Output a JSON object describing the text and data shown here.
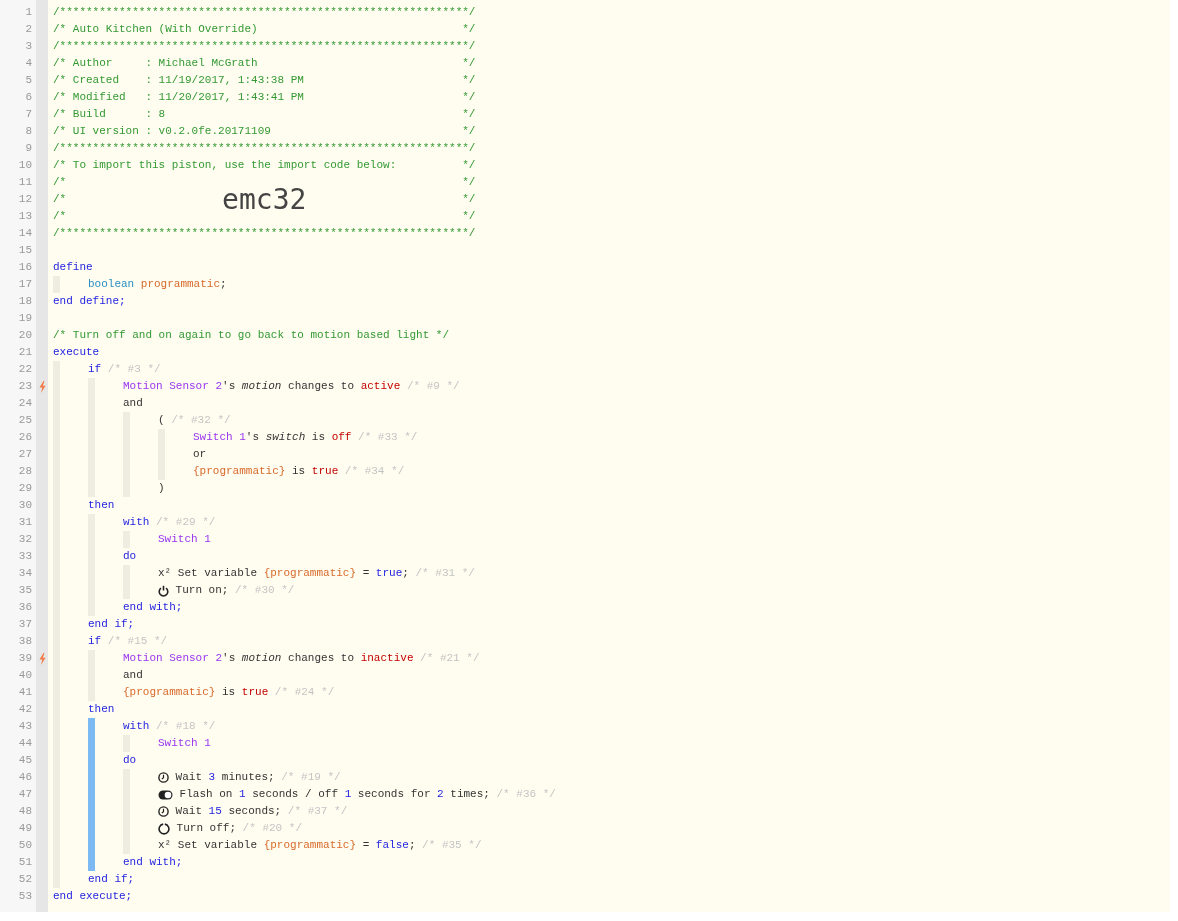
{
  "lines": [
    {
      "number": "1",
      "kind": "banner",
      "trigger": false,
      "text": "/**************************************************************/"
    },
    {
      "number": "2",
      "kind": "banner",
      "trigger": false,
      "text": "/* Auto Kitchen (With Override)",
      "end": "*/"
    },
    {
      "number": "3",
      "kind": "banner",
      "trigger": false,
      "text": "/**************************************************************/"
    },
    {
      "number": "4",
      "kind": "banner",
      "trigger": false,
      "text": "/* Author     : Michael McGrath",
      "end": "*/"
    },
    {
      "number": "5",
      "kind": "banner",
      "trigger": false,
      "text": "/* Created    : 11/19/2017, 1:43:38 PM",
      "end": "*/"
    },
    {
      "number": "6",
      "kind": "banner",
      "trigger": false,
      "text": "/* Modified   : 11/20/2017, 1:43:41 PM",
      "end": "*/"
    },
    {
      "number": "7",
      "kind": "banner",
      "trigger": false,
      "text": "/* Build      : 8",
      "end": "*/"
    },
    {
      "number": "8",
      "kind": "banner",
      "trigger": false,
      "text": "/* UI version : v0.2.0fe.20171109",
      "end": "*/"
    },
    {
      "number": "9",
      "kind": "banner",
      "trigger": false,
      "text": "/**************************************************************/"
    },
    {
      "number": "10",
      "kind": "banner",
      "trigger": false,
      "text": "/* To import this piston, use the import code below:",
      "end": "*/"
    },
    {
      "number": "11",
      "kind": "banner",
      "trigger": false,
      "text": "/*",
      "end": "*/"
    },
    {
      "number": "12",
      "kind": "banner",
      "trigger": false,
      "text": "/*",
      "code": "emc32",
      "end": "*/"
    },
    {
      "number": "13",
      "kind": "banner",
      "trigger": false,
      "text": "/*",
      "end": "*/"
    },
    {
      "number": "14",
      "kind": "banner",
      "trigger": false,
      "text": "/**************************************************************/"
    },
    {
      "number": "15",
      "kind": "code",
      "trigger": false
    },
    {
      "number": "16",
      "kind": "code",
      "trigger": false,
      "tokens": [
        {
          "text": "define",
          "kind": "keyword"
        }
      ]
    },
    {
      "kind": "block",
      "highlighted": false,
      "children": [
        {
          "number": "17",
          "kind": "code",
          "trigger": false,
          "tokens": [
            {
              "text": "boolean ",
              "kind": "type"
            },
            {
              "text": "programmatic",
              "kind": "variable"
            },
            {
              "text": ";",
              "kind": "plain"
            }
          ]
        }
      ]
    },
    {
      "number": "18",
      "kind": "code",
      "trigger": false,
      "tokens": [
        {
          "text": "end define;",
          "kind": "keyword"
        }
      ]
    },
    {
      "number": "19",
      "kind": "code",
      "trigger": false
    },
    {
      "number": "20",
      "kind": "code",
      "trigger": false,
      "tokens": [
        {
          "text": "/* Turn off and on again to go back to motion based light */",
          "kind": "comment"
        }
      ]
    },
    {
      "number": "21",
      "kind": "code",
      "trigger": false,
      "tokens": [
        {
          "text": "execute",
          "kind": "keyword"
        }
      ]
    },
    {
      "kind": "block",
      "highlighted": false,
      "children": [
        {
          "number": "22",
          "kind": "code",
          "trigger": false,
          "tokens": [
            {
              "text": "if",
              "kind": "keyword"
            },
            {
              "text": " /* #3 */",
              "kind": "hint"
            }
          ]
        },
        {
          "kind": "block",
          "highlighted": false,
          "children": [
            {
              "number": "23",
              "kind": "code",
              "trigger": true,
              "tokens": [
                {
                  "text": "Motion Sensor 2",
                  "kind": "device"
                },
                {
                  "text": "'s ",
                  "kind": "plain"
                },
                {
                  "text": "motion",
                  "kind": "attribute"
                },
                {
                  "text": " changes to ",
                  "kind": "plain"
                },
                {
                  "text": "active",
                  "kind": "value"
                },
                {
                  "text": " /* #9 */",
                  "kind": "hint"
                }
              ]
            },
            {
              "number": "24",
              "kind": "code",
              "trigger": false,
              "tokens": [
                {
                  "text": "and",
                  "kind": "plain"
                }
              ]
            },
            {
              "kind": "block",
              "highlighted": false,
              "children": [
                {
                  "number": "25",
                  "kind": "code",
                  "trigger": false,
                  "tokens": [
                    {
                      "text": "(",
                      "kind": "plain"
                    },
                    {
                      "text": " /* #32 */",
                      "kind": "hint"
                    }
                  ]
                },
                {
                  "kind": "block",
                  "highlighted": false,
                  "children": [
                    {
                      "number": "26",
                      "kind": "code",
                      "trigger": false,
                      "tokens": [
                        {
                          "text": "Switch 1",
                          "kind": "device"
                        },
                        {
                          "text": "'s ",
                          "kind": "plain"
                        },
                        {
                          "text": "switch",
                          "kind": "attribute"
                        },
                        {
                          "text": " is ",
                          "kind": "plain"
                        },
                        {
                          "text": "off",
                          "kind": "value"
                        },
                        {
                          "text": " /* #33 */",
                          "kind": "hint"
                        }
                      ]
                    },
                    {
                      "number": "27",
                      "kind": "code",
                      "trigger": false,
                      "tokens": [
                        {
                          "text": "or",
                          "kind": "plain"
                        }
                      ]
                    },
                    {
                      "number": "28",
                      "kind": "code",
                      "trigger": false,
                      "tokens": [
                        {
                          "text": "{programmatic}",
                          "kind": "variable"
                        },
                        {
                          "text": " is ",
                          "kind": "plain"
                        },
                        {
                          "text": "true",
                          "kind": "value"
                        },
                        {
                          "text": " /* #34 */",
                          "kind": "hint"
                        }
                      ]
                    }
                  ]
                },
                {
                  "number": "29",
                  "kind": "code",
                  "trigger": false,
                  "tokens": [
                    {
                      "text": ")",
                      "kind": "plain"
                    }
                  ]
                }
              ]
            }
          ]
        },
        {
          "number": "30",
          "kind": "code",
          "trigger": false,
          "tokens": [
            {
              "text": "then",
              "kind": "keyword"
            }
          ]
        },
        {
          "kind": "block",
          "highlighted": false,
          "children": [
            {
              "number": "31",
              "kind": "code",
              "trigger": false,
              "tokens": [
                {
                  "text": "with",
                  "kind": "keyword"
                },
                {
                  "text": " /* #29 */",
                  "kind": "hint"
                }
              ]
            },
            {
              "kind": "block",
              "highlighted": false,
              "children": [
                {
                  "number": "32",
                  "kind": "code",
                  "trigger": false,
                  "tokens": [
                    {
                      "text": "Switch 1",
                      "kind": "device"
                    }
                  ]
                }
              ]
            },
            {
              "number": "33",
              "kind": "code",
              "trigger": false,
              "tokens": [
                {
                  "text": "do",
                  "kind": "keyword"
                }
              ]
            },
            {
              "kind": "block",
              "highlighted": false,
              "children": [
                {
                  "number": "34",
                  "kind": "code",
                  "trigger": false,
                  "tokens": [
                    {
                      "text": "x² Set variable ",
                      "kind": "plain"
                    },
                    {
                      "text": "{programmatic}",
                      "kind": "variable"
                    },
                    {
                      "text": " = ",
                      "kind": "plain"
                    },
                    {
                      "text": "true",
                      "kind": "literal"
                    },
                    {
                      "text": ";",
                      "kind": "plain"
                    },
                    {
                      "text": " /* #31 */",
                      "kind": "hint"
                    }
                  ]
                },
                {
                  "number": "35",
                  "kind": "code",
                  "trigger": false,
                  "tokens": [
                    {
                      "kind": "on"
                    },
                    {
                      "text": " Turn on;",
                      "kind": "plain"
                    },
                    {
                      "text": " /* #30 */",
                      "kind": "hint"
                    }
                  ]
                }
              ]
            },
            {
              "number": "36",
              "kind": "code",
              "trigger": false,
              "tokens": [
                {
                  "text": "end with;",
                  "kind": "keyword"
                }
              ]
            }
          ]
        },
        {
          "number": "37",
          "kind": "code",
          "trigger": false,
          "tokens": [
            {
              "text": "end if;",
              "kind": "keyword"
            }
          ]
        },
        {
          "number": "38",
          "kind": "code",
          "trigger": false,
          "tokens": [
            {
              "text": "if",
              "kind": "keyword"
            },
            {
              "text": " /* #15 */",
              "kind": "hint"
            }
          ]
        },
        {
          "kind": "block",
          "highlighted": false,
          "children": [
            {
              "number": "39",
              "kind": "code",
              "trigger": true,
              "tokens": [
                {
                  "text": "Motion Sensor 2",
                  "kind": "device"
                },
                {
                  "text": "'s ",
                  "kind": "plain"
                },
                {
                  "text": "motion",
                  "kind": "attribute"
                },
                {
                  "text": " changes to ",
                  "kind": "plain"
                },
                {
                  "text": "inactive",
                  "kind": "value"
                },
                {
                  "text": " /* #21 */",
                  "kind": "hint"
                }
              ]
            },
            {
              "number": "40",
              "kind": "code",
              "trigger": false,
              "tokens": [
                {
                  "text": "and",
                  "kind": "plain"
                }
              ]
            },
            {
              "number": "41",
              "kind": "code",
              "trigger": false,
              "tokens": [
                {
                  "text": "{programmatic}",
                  "kind": "variable"
                },
                {
                  "text": " is ",
                  "kind": "plain"
                },
                {
                  "text": "true",
                  "kind": "value"
                },
                {
                  "text": " /* #24 */",
                  "kind": "hint"
                }
              ]
            }
          ]
        },
        {
          "number": "42",
          "kind": "code",
          "trigger": false,
          "tokens": [
            {
              "text": "then",
              "kind": "keyword"
            }
          ]
        },
        {
          "kind": "block",
          "highlighted": true,
          "children": [
            {
              "number": "43",
              "kind": "code",
              "trigger": false,
              "tokens": [
                {
                  "text": "with",
                  "kind": "keyword"
                },
                {
                  "text": " /* #18 */",
                  "kind": "hint"
                }
              ]
            },
            {
              "kind": "block",
              "highlighted": false,
              "children": [
                {
                  "number": "44",
                  "kind": "code",
                  "trigger": false,
                  "tokens": [
                    {
                      "text": "Switch 1",
                      "kind": "device"
                    }
                  ]
                }
              ]
            },
            {
              "number": "45",
              "kind": "code",
              "trigger": false,
              "tokens": [
                {
                  "text": "do",
                  "kind": "keyword"
                }
              ]
            },
            {
              "kind": "block",
              "highlighted": false,
              "children": [
                {
                  "number": "46",
                  "kind": "code",
                  "trigger": false,
                  "tokens": [
                    {
                      "kind": "wait"
                    },
                    {
                      "text": " Wait ",
                      "kind": "plain"
                    },
                    {
                      "text": "3",
                      "kind": "literal"
                    },
                    {
                      "text": " minutes;",
                      "kind": "plain"
                    },
                    {
                      "text": " /* #19 */",
                      "kind": "hint"
                    }
                  ]
                },
                {
                  "number": "47",
                  "kind": "code",
                  "trigger": false,
                  "tokens": [
                    {
                      "kind": "flash"
                    },
                    {
                      "text": " Flash on ",
                      "kind": "plain"
                    },
                    {
                      "text": "1",
                      "kind": "literal"
                    },
                    {
                      "text": " seconds / off ",
                      "kind": "plain"
                    },
                    {
                      "text": "1",
                      "kind": "literal"
                    },
                    {
                      "text": " seconds for ",
                      "kind": "plain"
                    },
                    {
                      "text": "2",
                      "kind": "literal"
                    },
                    {
                      "text": " times;",
                      "kind": "plain"
                    },
                    {
                      "text": " /* #36 */",
                      "kind": "hint"
                    }
                  ]
                },
                {
                  "number": "48",
                  "kind": "code",
                  "trigger": false,
                  "tokens": [
                    {
                      "kind": "wait"
                    },
                    {
                      "text": " Wait ",
                      "kind": "plain"
                    },
                    {
                      "text": "15",
                      "kind": "literal"
                    },
                    {
                      "text": " seconds;",
                      "kind": "plain"
                    },
                    {
                      "text": " /* #37 */",
                      "kind": "hint"
                    }
                  ]
                },
                {
                  "number": "49",
                  "kind": "code",
                  "trigger": false,
                  "tokens": [
                    {
                      "kind": "off"
                    },
                    {
                      "text": " Turn off;",
                      "kind": "plain"
                    },
                    {
                      "text": " /* #20 */",
                      "kind": "hint"
                    }
                  ]
                },
                {
                  "number": "50",
                  "kind": "code",
                  "trigger": false,
                  "tokens": [
                    {
                      "text": "x² Set variable ",
                      "kind": "plain"
                    },
                    {
                      "text": "{programmatic}",
                      "kind": "variable"
                    },
                    {
                      "text": " = ",
                      "kind": "plain"
                    },
                    {
                      "text": "false",
                      "kind": "literal"
                    },
                    {
                      "text": ";",
                      "kind": "plain"
                    },
                    {
                      "text": " /* #35 */",
                      "kind": "hint"
                    }
                  ]
                }
              ]
            },
            {
              "number": "51",
              "kind": "code",
              "trigger": false,
              "tokens": [
                {
                  "text": "end with;",
                  "kind": "keyword"
                }
              ]
            }
          ]
        },
        {
          "number": "52",
          "kind": "code",
          "trigger": false,
          "tokens": [
            {
              "text": "end if;",
              "kind": "keyword"
            }
          ]
        }
      ]
    },
    {
      "number": "53",
      "kind": "code",
      "trigger": false,
      "tokens": [
        {
          "text": "end execute;",
          "kind": "keyword"
        }
      ]
    }
  ]
}
